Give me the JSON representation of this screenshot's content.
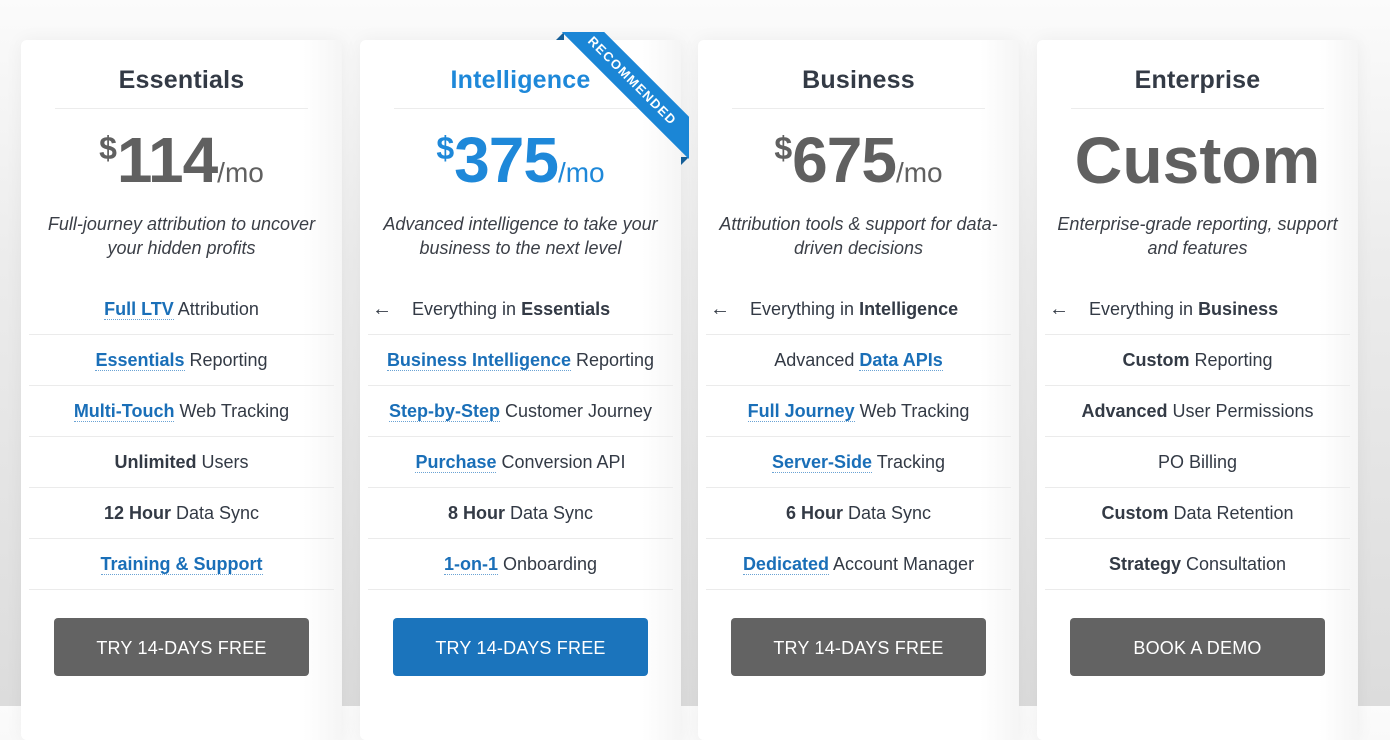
{
  "colors": {
    "accent": "#1e88d9",
    "link": "#1a6fb8",
    "primary_button": "#1b74bc",
    "secondary_button": "#636363",
    "price_gray": "#606060",
    "heading": "#333a45"
  },
  "plans": [
    {
      "name": "Essentials",
      "price": {
        "currency": "$",
        "amount": "114",
        "period": "/mo"
      },
      "description": "Full-journey attribution to uncover your hidden profits",
      "features": [
        {
          "parts": [
            {
              "text": "Full LTV",
              "style": "link"
            },
            {
              "text": " Attribution",
              "style": "plain"
            }
          ]
        },
        {
          "parts": [
            {
              "text": "Essentials",
              "style": "link"
            },
            {
              "text": " Reporting",
              "style": "plain"
            }
          ]
        },
        {
          "parts": [
            {
              "text": "Multi-Touch",
              "style": "link"
            },
            {
              "text": " Web Tracking",
              "style": "plain"
            }
          ]
        },
        {
          "parts": [
            {
              "text": "Unlimited",
              "style": "bold"
            },
            {
              "text": " Users",
              "style": "plain"
            }
          ]
        },
        {
          "parts": [
            {
              "text": "12 Hour",
              "style": "bold"
            },
            {
              "text": " Data Sync",
              "style": "plain"
            }
          ]
        },
        {
          "parts": [
            {
              "text": "Training & Support",
              "style": "link"
            }
          ]
        }
      ],
      "cta": "TRY 14-DAYS FREE"
    },
    {
      "name": "Intelligence",
      "recommended": true,
      "ribbon": "RECOMMENDED",
      "price": {
        "currency": "$",
        "amount": "375",
        "period": "/mo"
      },
      "description": "Advanced intelligence to take your business to the next level",
      "features": [
        {
          "inherit": true,
          "icon": "arrow-left-icon",
          "parts": [
            {
              "text": "Everything in ",
              "style": "plain"
            },
            {
              "text": "Essentials",
              "style": "bold"
            }
          ]
        },
        {
          "parts": [
            {
              "text": "Business Intelligence",
              "style": "link"
            },
            {
              "text": " Reporting",
              "style": "plain"
            }
          ]
        },
        {
          "parts": [
            {
              "text": "Step-by-Step",
              "style": "link"
            },
            {
              "text": " Customer Journey",
              "style": "plain"
            }
          ]
        },
        {
          "parts": [
            {
              "text": "Purchase",
              "style": "link"
            },
            {
              "text": " Conversion API",
              "style": "plain"
            }
          ]
        },
        {
          "parts": [
            {
              "text": "8 Hour",
              "style": "bold"
            },
            {
              "text": " Data Sync",
              "style": "plain"
            }
          ]
        },
        {
          "parts": [
            {
              "text": "1-on-1",
              "style": "link"
            },
            {
              "text": " Onboarding",
              "style": "plain"
            }
          ]
        }
      ],
      "cta": "TRY 14-DAYS FREE"
    },
    {
      "name": "Business",
      "price": {
        "currency": "$",
        "amount": "675",
        "period": "/mo"
      },
      "description": "Attribution tools & support for data-driven decisions",
      "features": [
        {
          "inherit": true,
          "icon": "arrow-left-icon",
          "parts": [
            {
              "text": "Everything in ",
              "style": "plain"
            },
            {
              "text": "Intelligence",
              "style": "bold"
            }
          ]
        },
        {
          "parts": [
            {
              "text": "Advanced ",
              "style": "plain"
            },
            {
              "text": "Data APIs",
              "style": "link"
            }
          ]
        },
        {
          "parts": [
            {
              "text": "Full Journey",
              "style": "link"
            },
            {
              "text": " Web Tracking",
              "style": "plain"
            }
          ]
        },
        {
          "parts": [
            {
              "text": "Server-Side",
              "style": "link"
            },
            {
              "text": " Tracking",
              "style": "plain"
            }
          ]
        },
        {
          "parts": [
            {
              "text": "6 Hour",
              "style": "bold"
            },
            {
              "text": " Data Sync",
              "style": "plain"
            }
          ]
        },
        {
          "parts": [
            {
              "text": "Dedicated",
              "style": "link"
            },
            {
              "text": " Account Manager",
              "style": "plain"
            }
          ]
        }
      ],
      "cta": "TRY 14-DAYS FREE"
    },
    {
      "name": "Enterprise",
      "price": {
        "currency": "",
        "amount": "Custom",
        "period": ""
      },
      "description": "Enterprise-grade reporting, support and features",
      "features": [
        {
          "inherit": true,
          "icon": "arrow-left-icon",
          "parts": [
            {
              "text": "Everything in ",
              "style": "plain"
            },
            {
              "text": "Business",
              "style": "bold"
            }
          ]
        },
        {
          "parts": [
            {
              "text": "Custom",
              "style": "bold"
            },
            {
              "text": " Reporting",
              "style": "plain"
            }
          ]
        },
        {
          "parts": [
            {
              "text": "Advanced",
              "style": "bold"
            },
            {
              "text": " User Permissions",
              "style": "plain"
            }
          ]
        },
        {
          "parts": [
            {
              "text": "PO Billing",
              "style": "plain"
            }
          ]
        },
        {
          "parts": [
            {
              "text": "Custom",
              "style": "bold"
            },
            {
              "text": " Data Retention",
              "style": "plain"
            }
          ]
        },
        {
          "parts": [
            {
              "text": "Strategy",
              "style": "bold"
            },
            {
              "text": " Consultation",
              "style": "plain"
            }
          ]
        }
      ],
      "cta": "BOOK A DEMO"
    }
  ]
}
